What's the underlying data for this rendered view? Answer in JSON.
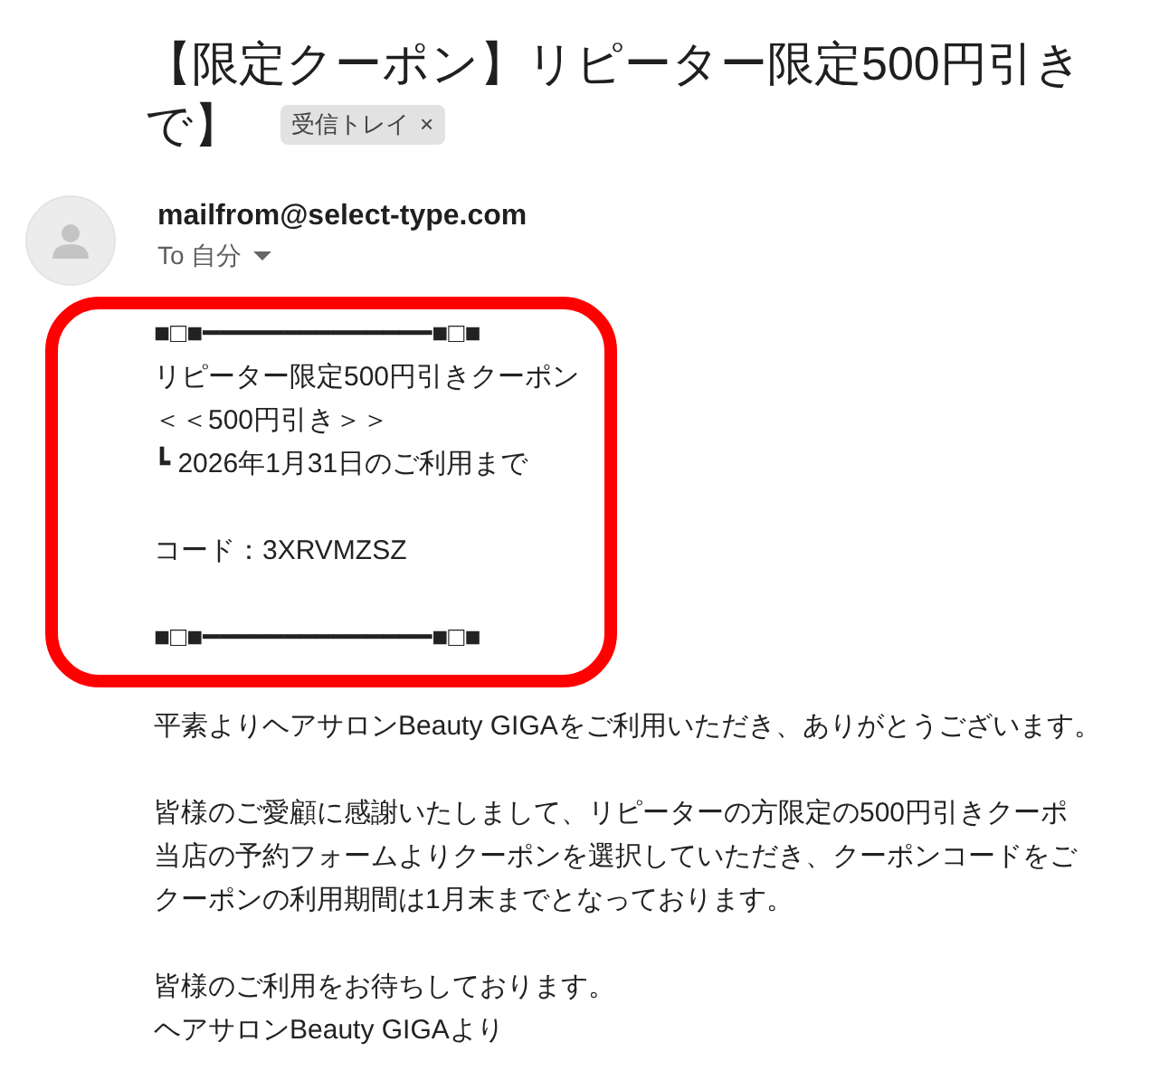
{
  "subject": {
    "lines": [
      "【限定クーポン】リピーター限定500円引き",
      "で】"
    ]
  },
  "label_chip": {
    "text": "受信トレイ",
    "close": "×"
  },
  "sender": {
    "address": "mailfrom@select-type.com",
    "recipient": "To 自分"
  },
  "coupon": {
    "paragraphs": [
      [
        "■□■━━━━━━━━━━━━━━■□■",
        "リピーター限定500円引きクーポン",
        "＜＜500円引き＞＞",
        "┗ 2026年1月31日のご利用まで"
      ],
      [
        "コード：3XRVMZSZ"
      ],
      [
        "■□■━━━━━━━━━━━━━━■□■"
      ]
    ]
  },
  "body": {
    "paragraphs": [
      [
        "平素よりヘアサロンBeauty GIGAをご利用いただき、ありがとうございます。"
      ],
      [
        "皆様のご愛顧に感謝いたしまして、リピーターの方限定の500円引きクーポ",
        "当店の予約フォームよりクーポンを選択していただき、クーポンコードをご",
        "クーポンの利用期間は1月末までとなっております。"
      ],
      [
        "皆様のご利用をお待ちしております。",
        "ヘアサロンBeauty GIGAより"
      ]
    ]
  }
}
